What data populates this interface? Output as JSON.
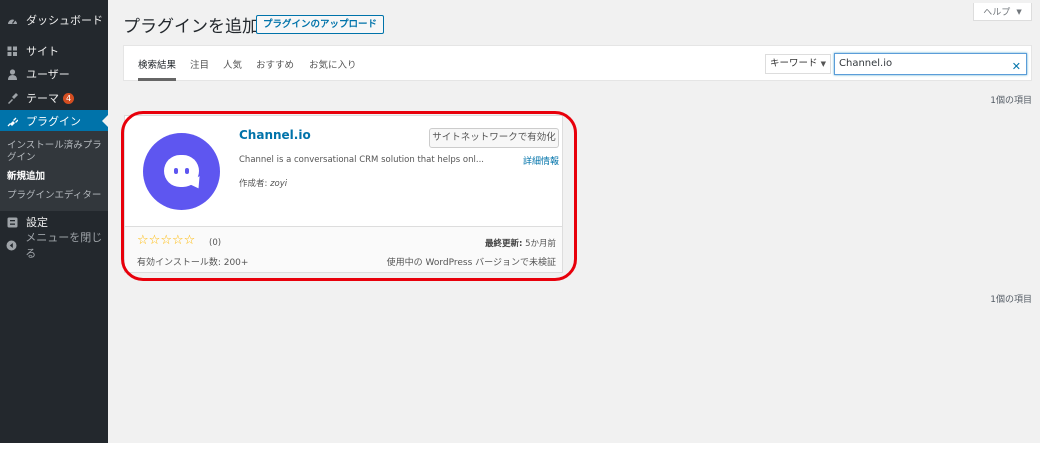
{
  "sidebar": {
    "items": [
      {
        "label": "ダッシュボード",
        "icon": "dashboard-icon"
      },
      {
        "label": "サイト",
        "icon": "sites-icon"
      },
      {
        "label": "ユーザー",
        "icon": "users-icon"
      },
      {
        "label": "テーマ",
        "icon": "themes-icon",
        "badge": "4"
      },
      {
        "label": "プラグイン",
        "icon": "plugins-icon",
        "active": true
      },
      {
        "label": "設定",
        "icon": "settings-icon"
      },
      {
        "label": "メニューを閉じる",
        "icon": "collapse-menu-icon"
      }
    ],
    "submenu": [
      "インストール済みプラグイン",
      "新規追加",
      "プラグインエディター"
    ]
  },
  "header": {
    "title": "プラグインを追加",
    "upload_label": "プラグインのアップロード",
    "help_label": "ヘルプ"
  },
  "filter": {
    "tabs": [
      "検索結果",
      "注目",
      "人気",
      "おすすめ",
      "お気に入り"
    ],
    "current": "検索結果",
    "search_type": "キーワード",
    "search_value": "Channel.io"
  },
  "results": {
    "count_top": "1個の項目",
    "count_bottom": "1個の項目"
  },
  "plugin": {
    "name": "Channel.io",
    "action_label": "サイトネットワークで有効化",
    "description": "Channel is a conversational CRM solution that helps onl...",
    "details_label": "詳細情報",
    "author_prefix": "作成者:",
    "author": "zoyi",
    "stars": 0,
    "rating_count": "(0)",
    "installs": "有効インストール数: 200+",
    "last_updated_label": "最終更新:",
    "last_updated": "5か月前",
    "compat": "使用中の WordPress バージョンで未検証"
  },
  "colors": {
    "sidebar_bg": "#23282d",
    "accent": "#0073aa",
    "badge": "#d54e21",
    "plugin_icon_bg": "#5e56f0",
    "highlight": "#e8000b",
    "stars": "#ffb900"
  }
}
